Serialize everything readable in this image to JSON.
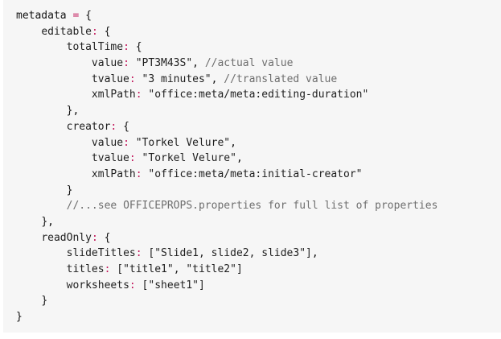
{
  "code": {
    "lines": [
      {
        "indent": "",
        "tokens": [
          {
            "t": "plain",
            "v": "metadata "
          },
          {
            "t": "assign",
            "v": "="
          },
          {
            "t": "plain",
            "v": " {"
          }
        ]
      },
      {
        "indent": "    ",
        "tokens": [
          {
            "t": "prop",
            "v": "editable"
          },
          {
            "t": "colon",
            "v": ":"
          },
          {
            "t": "plain",
            "v": " {"
          }
        ]
      },
      {
        "indent": "        ",
        "tokens": [
          {
            "t": "prop",
            "v": "totalTime"
          },
          {
            "t": "colon",
            "v": ":"
          },
          {
            "t": "plain",
            "v": " {"
          }
        ]
      },
      {
        "indent": "            ",
        "tokens": [
          {
            "t": "prop",
            "v": "value"
          },
          {
            "t": "colon",
            "v": ":"
          },
          {
            "t": "string",
            "v": " \"PT3M43S\""
          },
          {
            "t": "plain",
            "v": ", "
          },
          {
            "t": "comment",
            "v": "//actual value"
          }
        ]
      },
      {
        "indent": "            ",
        "tokens": [
          {
            "t": "prop",
            "v": "tvalue"
          },
          {
            "t": "colon",
            "v": ":"
          },
          {
            "t": "string",
            "v": " \"3 minutes\""
          },
          {
            "t": "plain",
            "v": ", "
          },
          {
            "t": "comment",
            "v": "//translated value"
          }
        ]
      },
      {
        "indent": "            ",
        "tokens": [
          {
            "t": "prop",
            "v": "xmlPath"
          },
          {
            "t": "colon",
            "v": ":"
          },
          {
            "t": "string",
            "v": " \"office:meta/meta:editing-duration\""
          }
        ]
      },
      {
        "indent": "        ",
        "tokens": [
          {
            "t": "plain",
            "v": "},"
          }
        ]
      },
      {
        "indent": "        ",
        "tokens": [
          {
            "t": "prop",
            "v": "creator"
          },
          {
            "t": "colon",
            "v": ":"
          },
          {
            "t": "plain",
            "v": " {"
          }
        ]
      },
      {
        "indent": "            ",
        "tokens": [
          {
            "t": "prop",
            "v": "value"
          },
          {
            "t": "colon",
            "v": ":"
          },
          {
            "t": "string",
            "v": " \"Torkel Velure\""
          },
          {
            "t": "plain",
            "v": ","
          }
        ]
      },
      {
        "indent": "            ",
        "tokens": [
          {
            "t": "prop",
            "v": "tvalue"
          },
          {
            "t": "colon",
            "v": ":"
          },
          {
            "t": "string",
            "v": " \"Torkel Velure\""
          },
          {
            "t": "plain",
            "v": ","
          }
        ]
      },
      {
        "indent": "            ",
        "tokens": [
          {
            "t": "prop",
            "v": "xmlPath"
          },
          {
            "t": "colon",
            "v": ":"
          },
          {
            "t": "string",
            "v": " \"office:meta/meta:initial-creator\""
          }
        ]
      },
      {
        "indent": "        ",
        "tokens": [
          {
            "t": "plain",
            "v": "}"
          }
        ]
      },
      {
        "indent": "        ",
        "tokens": [
          {
            "t": "comment",
            "v": "//...see OFFICEPROPS.properties for full list of properties"
          }
        ]
      },
      {
        "indent": "    ",
        "tokens": [
          {
            "t": "plain",
            "v": "},"
          }
        ]
      },
      {
        "indent": "    ",
        "tokens": [
          {
            "t": "prop",
            "v": "readOnly"
          },
          {
            "t": "colon",
            "v": ":"
          },
          {
            "t": "plain",
            "v": " {"
          }
        ]
      },
      {
        "indent": "        ",
        "tokens": [
          {
            "t": "prop",
            "v": "slideTitles"
          },
          {
            "t": "colon",
            "v": ":"
          },
          {
            "t": "string",
            "v": " [\"Slide1, slide2, slide3\"]"
          },
          {
            "t": "plain",
            "v": ","
          }
        ]
      },
      {
        "indent": "        ",
        "tokens": [
          {
            "t": "prop",
            "v": "titles"
          },
          {
            "t": "colon",
            "v": ":"
          },
          {
            "t": "string",
            "v": " [\"title1\", \"title2\"]"
          }
        ]
      },
      {
        "indent": "        ",
        "tokens": [
          {
            "t": "prop",
            "v": "worksheets"
          },
          {
            "t": "colon",
            "v": ":"
          },
          {
            "t": "string",
            "v": " [\"sheet1\"]"
          }
        ]
      },
      {
        "indent": "    ",
        "tokens": [
          {
            "t": "plain",
            "v": "}"
          }
        ]
      },
      {
        "indent": "",
        "tokens": [
          {
            "t": "plain",
            "v": "}"
          }
        ]
      }
    ]
  },
  "colors": {
    "background": "#f6f6f6",
    "text": "#111111",
    "comment": "#6e6e6e",
    "punctuation_accent": "#c2185b"
  }
}
